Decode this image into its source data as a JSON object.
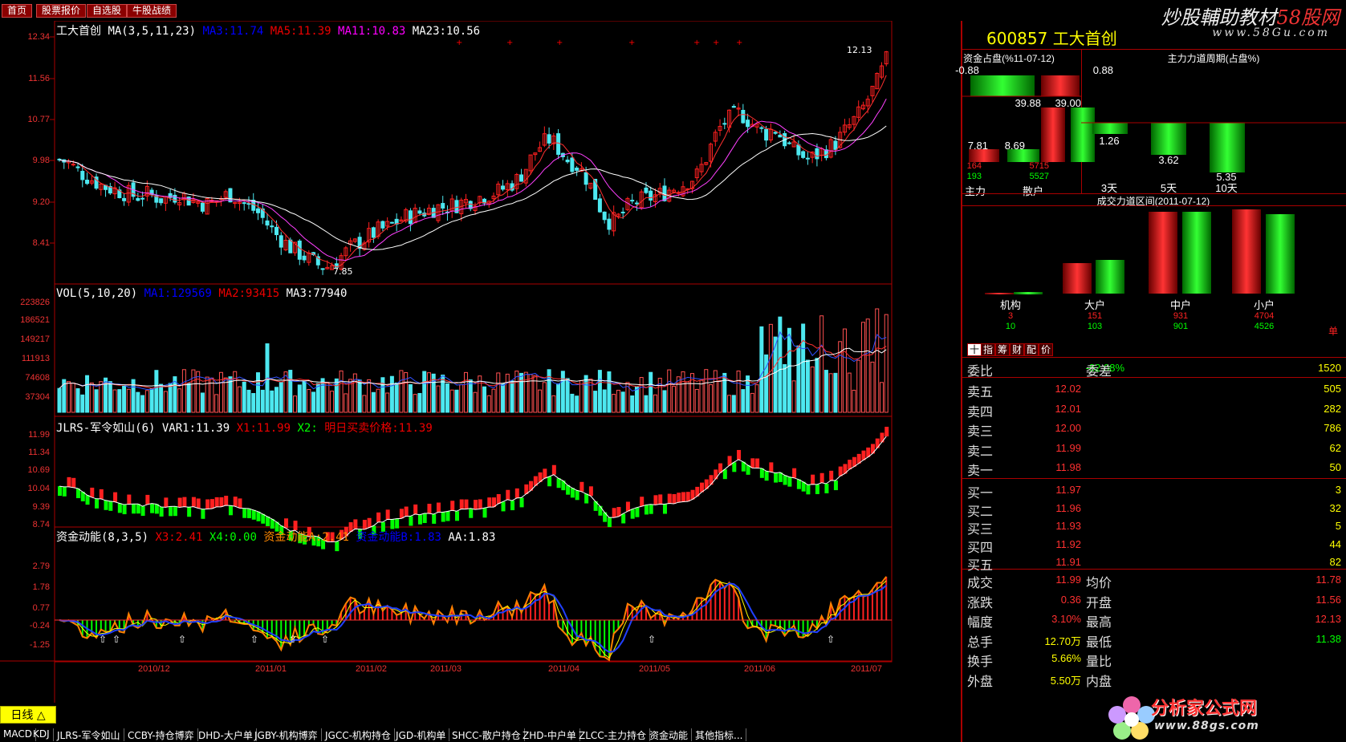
{
  "nav": {
    "items": [
      "首页",
      "股票报价",
      "自选股",
      "牛股战绩"
    ]
  },
  "brand": {
    "text1": "炒股輔助教材",
    "text2": "58股网",
    "site": "www.58Gu.com"
  },
  "kline": {
    "title": "工大首创",
    "ma_label": "MA(3,5,11,23)",
    "ma3": "MA3:11.74",
    "ma5": "MA5:11.39",
    "ma11": "MA11:10.83",
    "ma23": "MA23:10.56",
    "y_ticks": [
      "12.34",
      "11.56",
      "10.77",
      "9.98",
      "9.20",
      "8.41"
    ],
    "high_label": "12.13",
    "low_label": "7.85"
  },
  "vol": {
    "label": "VOL(5,10,20)",
    "ma1": "MA1:129569",
    "ma2": "MA2:93415",
    "ma3": "MA3:77940",
    "y_ticks": [
      "223826",
      "186521",
      "149217",
      "111913",
      "74608",
      "37304"
    ]
  },
  "jlrs": {
    "label": "JLRS-军令如山(6)",
    "var1": "VAR1:11.39",
    "x1": "X1:11.99",
    "x2": "X2:",
    "note": "明日买卖价格:11.39",
    "y_ticks": [
      "11.99",
      "11.34",
      "10.69",
      "10.04",
      "9.39",
      "8.74"
    ]
  },
  "zjdn": {
    "label": "资金动能(8,3,5)",
    "x3": "X3:2.41",
    "x4": "X4:0.00",
    "a": "资金动能A:2.41",
    "b": "资金动能B:1.83",
    "aa": "AA:1.83",
    "y_ticks": [
      "2.79",
      "1.78",
      "0.77",
      "-0.24",
      "-1.25"
    ]
  },
  "x_axis": [
    "2010/12",
    "2011/01",
    "2011/02",
    "2011/03",
    "2011/04",
    "2011/05",
    "2011/06",
    "2011/07"
  ],
  "stock": {
    "code": "600857",
    "name": "工大首创"
  },
  "fund": {
    "title": "资金占盘(%11-07-12)",
    "v1": "-0.88",
    "v2": "0.88",
    "v3": "39.88",
    "v4": "39.00",
    "v5": "7.81",
    "v6": "8.69",
    "main_red": "164",
    "main_green": "193",
    "retail_red": "5715",
    "retail_green": "5527",
    "main_label": "主力",
    "retail_label": "散户"
  },
  "cycle": {
    "title": "主力力道周期(占盘%)",
    "values": [
      "1.26",
      "3.62",
      "5.35"
    ],
    "labels": [
      "3天",
      "5天",
      "10天"
    ]
  },
  "deal": {
    "title": "成交力道区间(2011-07-12)",
    "groups": [
      {
        "label": "机构",
        "red": "3",
        "green": "10"
      },
      {
        "label": "大户",
        "red": "151",
        "green": "103"
      },
      {
        "label": "中户",
        "red": "931",
        "green": "901"
      },
      {
        "label": "小户",
        "red": "4704",
        "green": "4526"
      }
    ],
    "unit": "单"
  },
  "tabs": [
    "指",
    "筹",
    "财",
    "配",
    "价"
  ],
  "tab_first": "十",
  "quote": {
    "weibi_label": "委比",
    "weibi": "-82.08%",
    "weicha_label": "委差",
    "weicha": "1520",
    "asks": [
      {
        "label": "卖五",
        "price": "12.02",
        "vol": "505"
      },
      {
        "label": "卖四",
        "price": "12.01",
        "vol": "282"
      },
      {
        "label": "卖三",
        "price": "12.00",
        "vol": "786"
      },
      {
        "label": "卖二",
        "price": "11.99",
        "vol": "62"
      },
      {
        "label": "卖一",
        "price": "11.98",
        "vol": "50"
      }
    ],
    "bids": [
      {
        "label": "买一",
        "price": "11.97",
        "vol": "3"
      },
      {
        "label": "买二",
        "price": "11.96",
        "vol": "32"
      },
      {
        "label": "买三",
        "price": "11.93",
        "vol": "5"
      },
      {
        "label": "买四",
        "price": "11.92",
        "vol": "44"
      },
      {
        "label": "买五",
        "price": "11.91",
        "vol": "82"
      }
    ],
    "stats": [
      {
        "l1": "成交",
        "v1": "11.99",
        "l2": "均价",
        "v2": "11.78"
      },
      {
        "l1": "涨跌",
        "v1": "0.36",
        "l2": "开盘",
        "v2": "11.56"
      },
      {
        "l1": "幅度",
        "v1": "3.10%",
        "l2": "最高",
        "v2": "12.13"
      },
      {
        "l1": "总手",
        "v1": "12.70万",
        "l2": "最低",
        "v2": "11.38"
      },
      {
        "l1": "换手",
        "v1": "5.66%",
        "l2": "量比",
        "v2": ""
      },
      {
        "l1": "外盘",
        "v1": "5.50万",
        "l2": "内盘",
        "v2": ""
      }
    ]
  },
  "day_label": "日线 △",
  "bottom_tabs": [
    "MACD",
    "KDJ",
    "JLRS-军令如山",
    "CCBY-持仓博弈",
    "DHD-大户单",
    "JGBY-机构博弈",
    "JGCC-机构持仓",
    "JGD-机构单",
    "SHCC-散户持仓",
    "ZHD-中户单",
    "ZLCC-主力持仓",
    "资金动能",
    "其他指标..."
  ],
  "logo": {
    "cn": "分析家公式网",
    "url": "www.88gs.com"
  },
  "colors": {
    "up": "#ff2020",
    "down": "#00ff00",
    "cyan": "#4de8f0",
    "grid": "#a00000",
    "text": "#e33333",
    "white": "#ffffff",
    "yellow": "#ffff00"
  }
}
